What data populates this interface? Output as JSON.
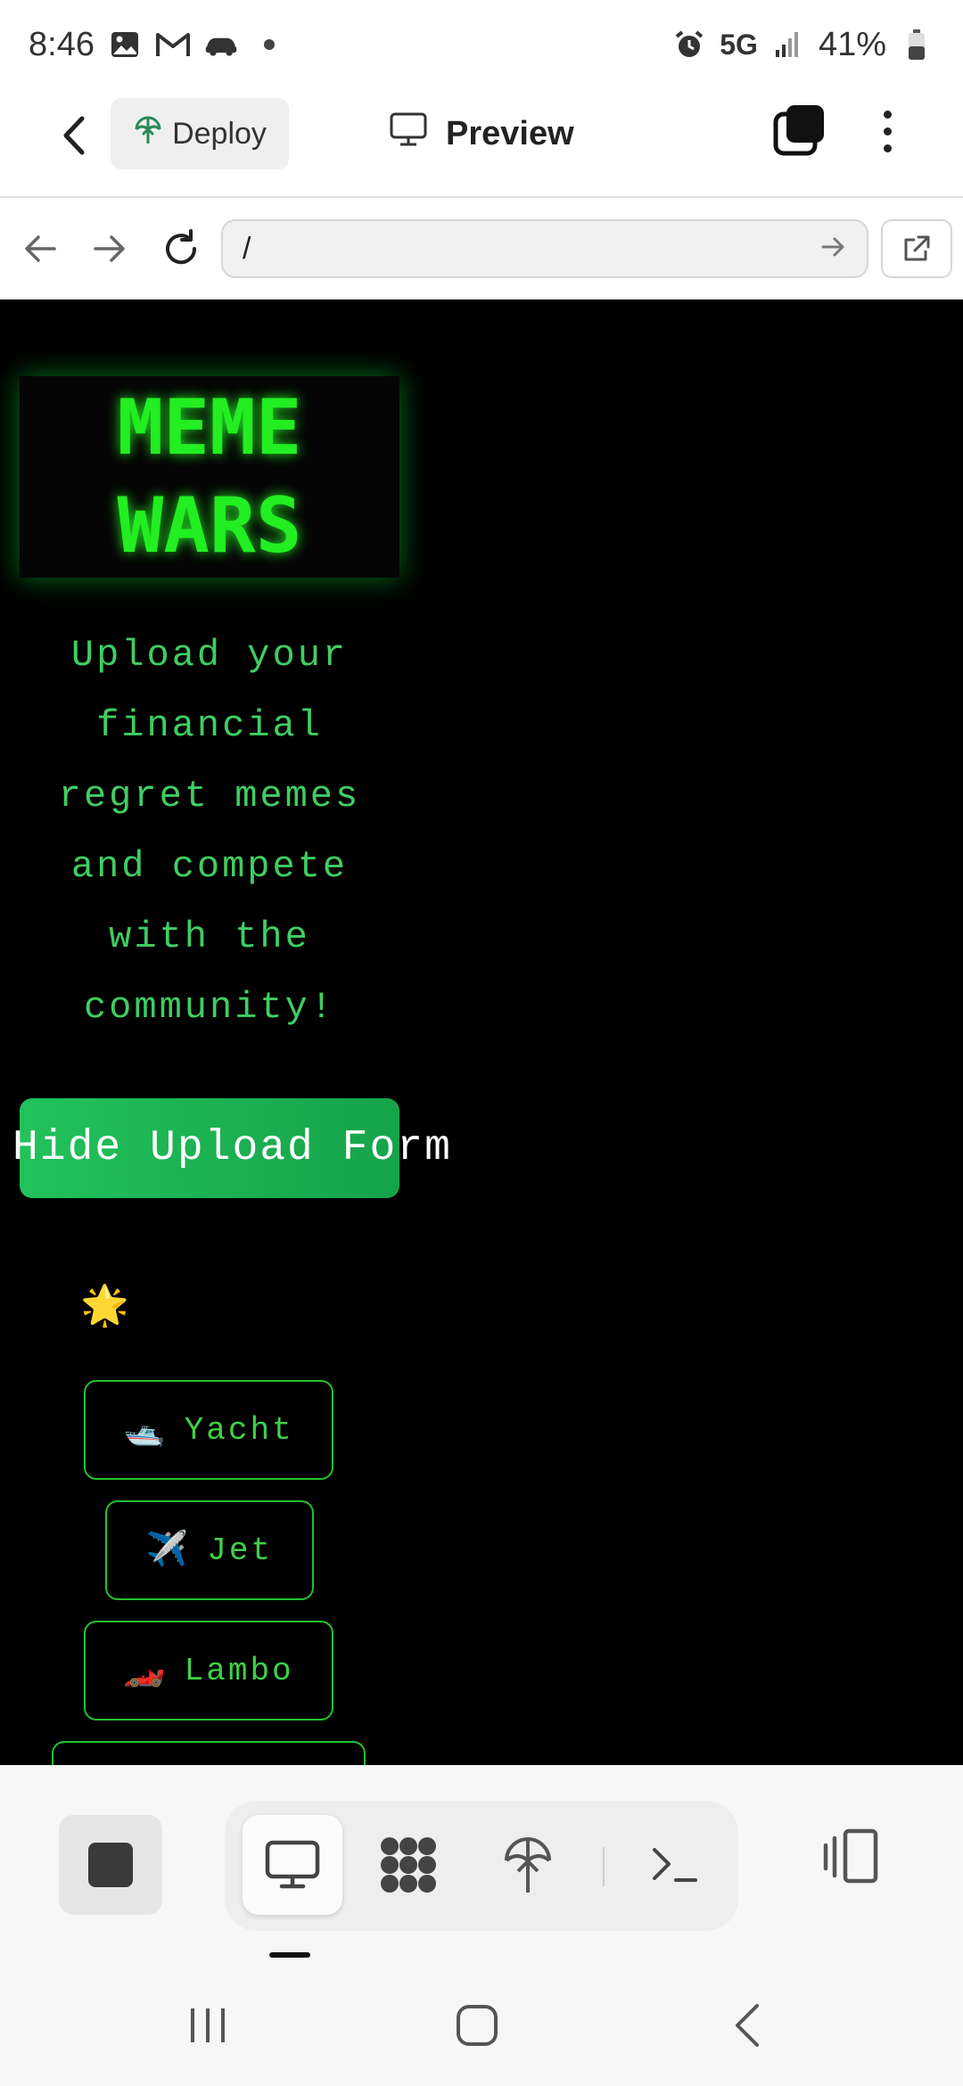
{
  "status_bar": {
    "time": "8:46",
    "network": "5G",
    "battery": "41%",
    "icons": [
      "gallery-icon",
      "gmail-icon",
      "car-icon",
      "alarm-icon",
      "signal-icon",
      "battery-icon"
    ]
  },
  "app_bar": {
    "deploy_label": "Deploy",
    "preview_label": "Preview"
  },
  "browser": {
    "url": "/"
  },
  "preview": {
    "title_line1": "MEME",
    "title_line2": "WARS",
    "subtitle": "Upload your financial regret memes and compete with the community!",
    "hide_upload_label": "Hide Upload Form",
    "sparkle": "🌟",
    "options": [
      {
        "emoji": "🛥️",
        "label": "Yacht"
      },
      {
        "emoji": "✈️",
        "label": "Jet"
      },
      {
        "emoji": "🏎️",
        "label": "Lambo"
      }
    ]
  },
  "colors": {
    "neon_green": "#22ee22",
    "button_green": "#22c25b",
    "preview_bg": "#000000"
  }
}
